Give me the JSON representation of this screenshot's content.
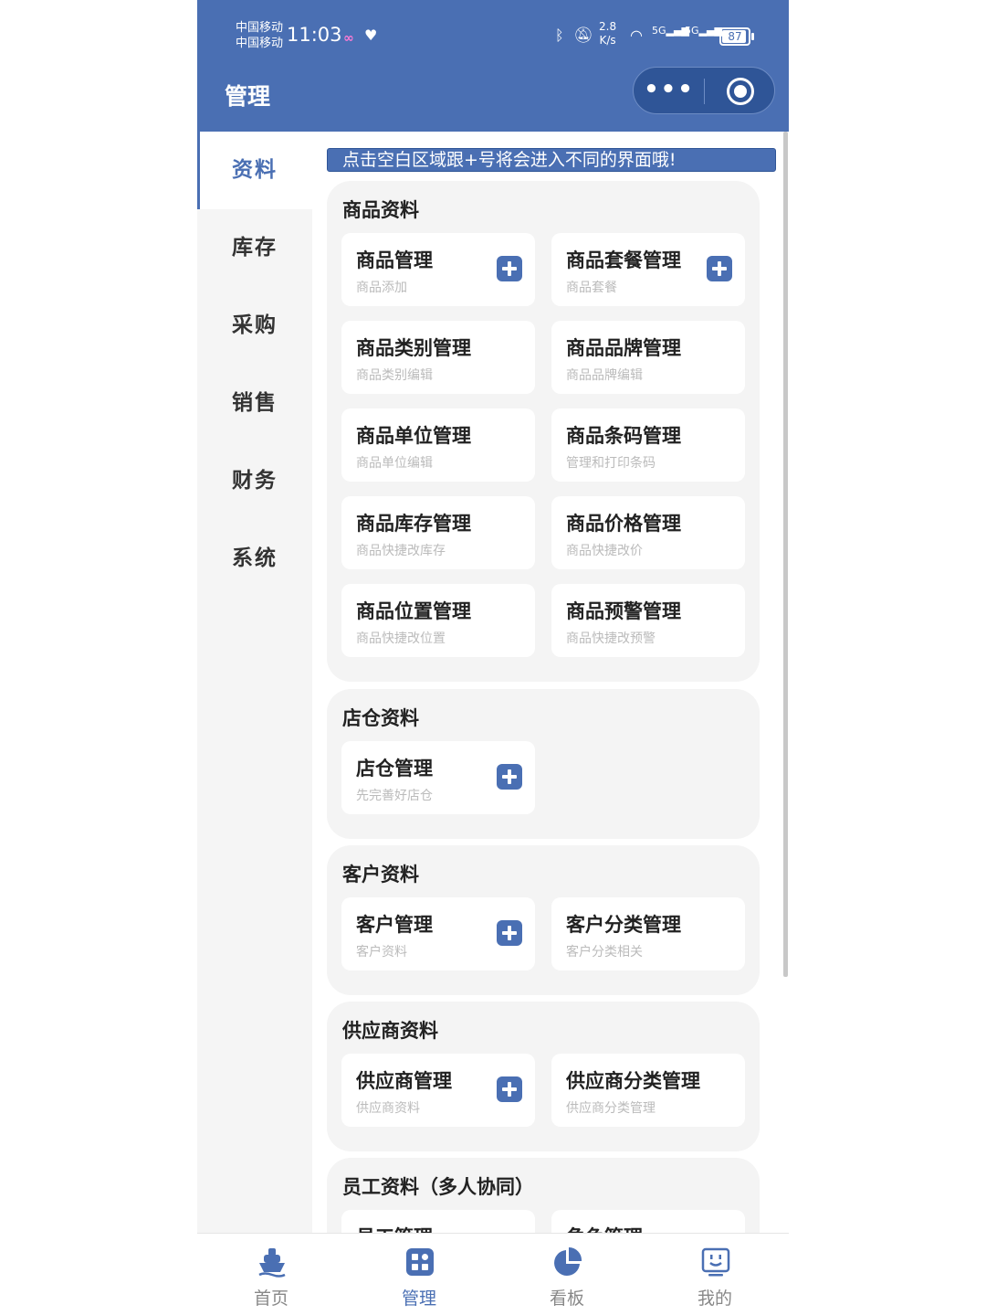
{
  "status_bar": {
    "carrier_1": "中国移动",
    "carrier_2": "中国移动",
    "time": "11:03",
    "speed_value": "2.8",
    "speed_unit": "K/s",
    "net_1": "5G",
    "net_2": "5G",
    "battery": "87"
  },
  "header": {
    "title": "管理"
  },
  "sidebar": {
    "items": [
      {
        "label": "资料"
      },
      {
        "label": "库存"
      },
      {
        "label": "采购"
      },
      {
        "label": "销售"
      },
      {
        "label": "财务"
      },
      {
        "label": "系统"
      }
    ],
    "active": "资料"
  },
  "notice": "点击空白区域跟+号将会进入不同的界面哦!",
  "sections": [
    {
      "title": "商品资料",
      "cards": [
        {
          "title": "商品管理",
          "sub": "商品添加",
          "plus": true
        },
        {
          "title": "商品套餐管理",
          "sub": "商品套餐",
          "plus": true
        },
        {
          "title": "商品类别管理",
          "sub": "商品类别编辑"
        },
        {
          "title": "商品品牌管理",
          "sub": "商品品牌编辑"
        },
        {
          "title": "商品单位管理",
          "sub": "商品单位编辑"
        },
        {
          "title": "商品条码管理",
          "sub": "管理和打印条码"
        },
        {
          "title": "商品库存管理",
          "sub": "商品快捷改库存"
        },
        {
          "title": "商品价格管理",
          "sub": "商品快捷改价"
        },
        {
          "title": "商品位置管理",
          "sub": "商品快捷改位置"
        },
        {
          "title": "商品预警管理",
          "sub": "商品快捷改预警"
        }
      ]
    },
    {
      "title": "店仓资料",
      "cards": [
        {
          "title": "店仓管理",
          "sub": "先完善好店仓",
          "plus": true
        }
      ]
    },
    {
      "title": "客户资料",
      "cards": [
        {
          "title": "客户管理",
          "sub": "客户资料",
          "plus": true
        },
        {
          "title": "客户分类管理",
          "sub": "客户分类相关"
        }
      ]
    },
    {
      "title": "供应商资料",
      "cards": [
        {
          "title": "供应商管理",
          "sub": "供应商资料",
          "plus": true
        },
        {
          "title": "供应商分类管理",
          "sub": "供应商分类管理"
        }
      ]
    },
    {
      "title": "员工资料（多人协同）",
      "cards": [
        {
          "title": "员工管理",
          "sub": "",
          "plus": true
        },
        {
          "title": "角色管理",
          "sub": "",
          "plus": true
        }
      ]
    }
  ],
  "tabbar": {
    "items": [
      {
        "label": "首页",
        "icon": "ship-icon"
      },
      {
        "label": "管理",
        "icon": "grid-icon"
      },
      {
        "label": "看板",
        "icon": "pie-chart-icon"
      },
      {
        "label": "我的",
        "icon": "monitor-face-icon"
      }
    ],
    "active": "管理"
  },
  "colors": {
    "brand": "#4a6fb3",
    "brand_dark": "#2f5597",
    "section_bg": "#f4f4f4"
  }
}
